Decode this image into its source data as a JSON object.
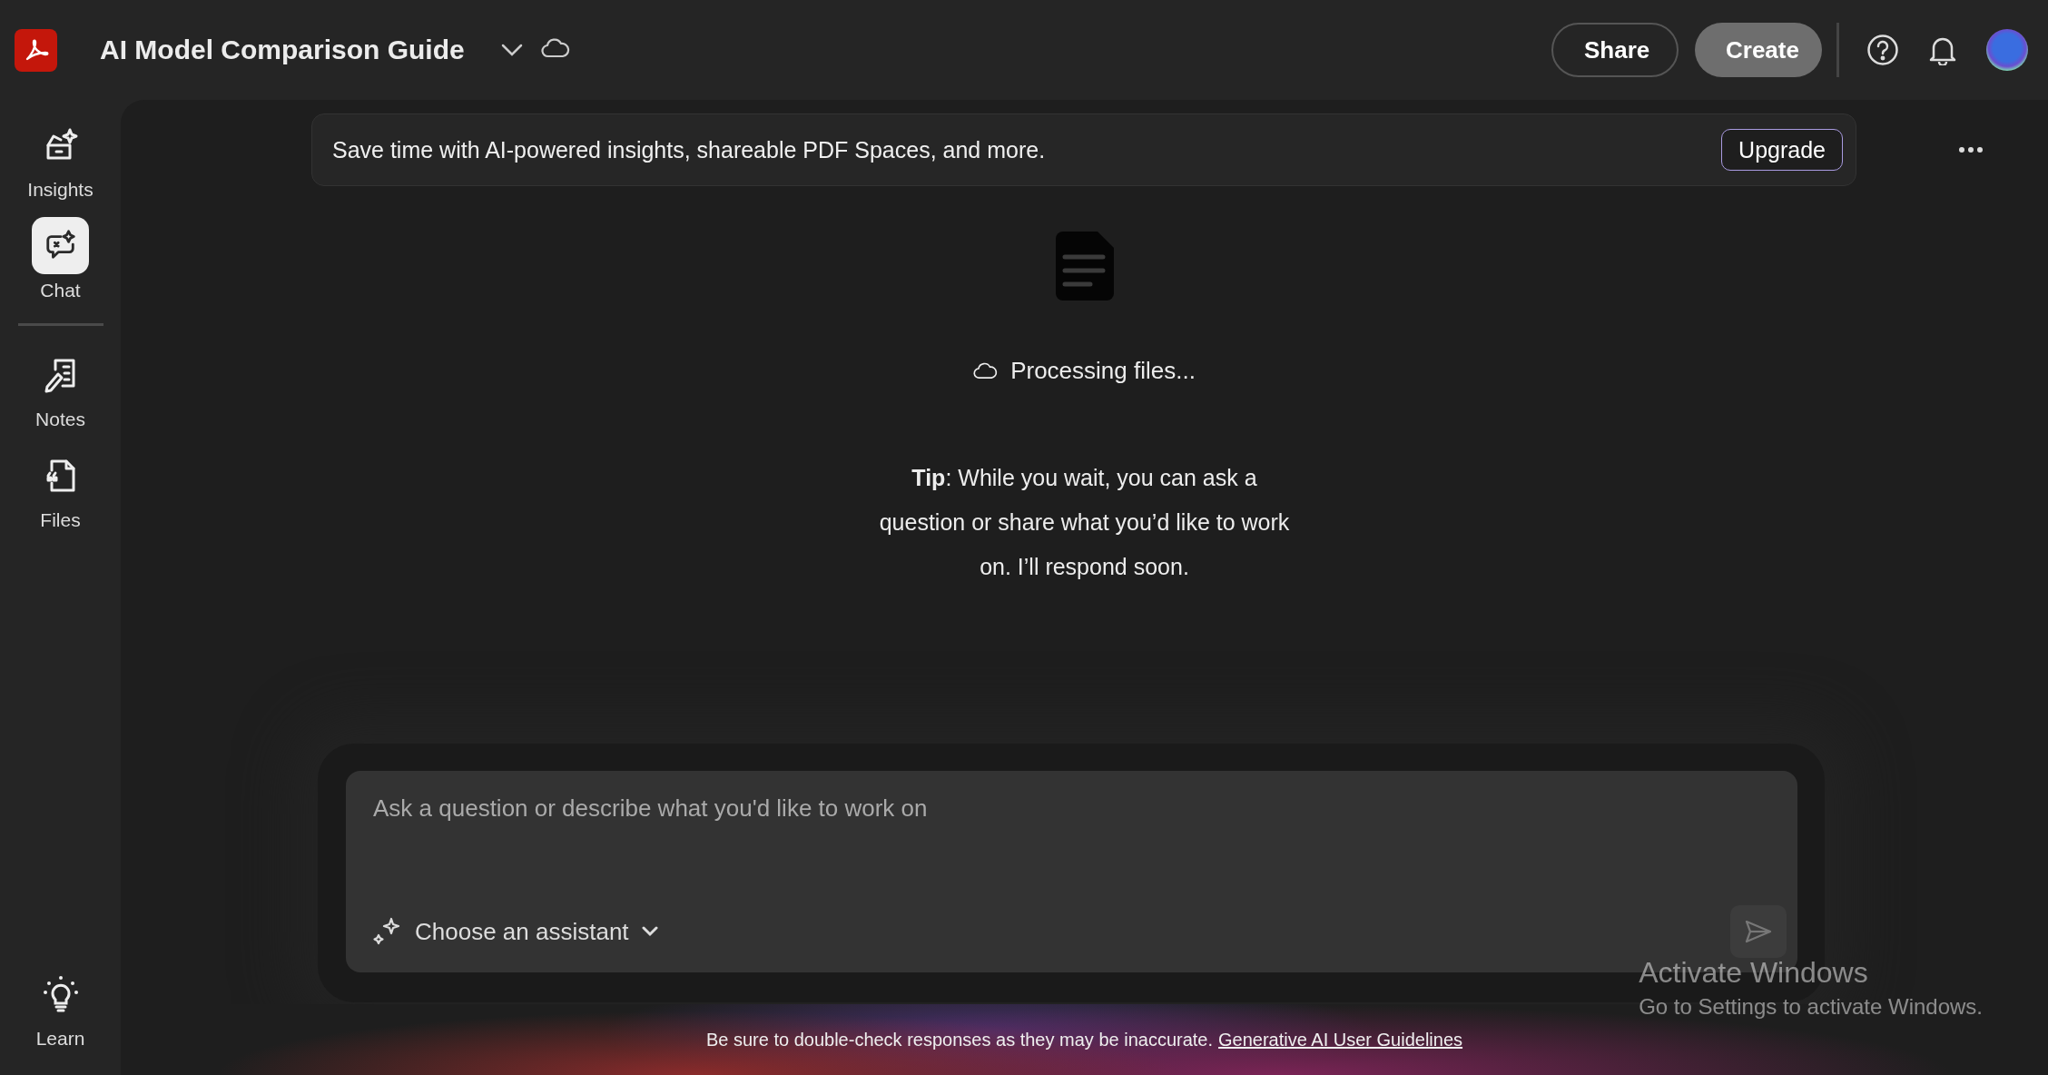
{
  "app": {
    "title": "AI Model Comparison Guide"
  },
  "header_actions": {
    "share": "Share",
    "create": "Create"
  },
  "sidebar": {
    "items": [
      {
        "label": "Insights",
        "kind": "insights",
        "selected": false
      },
      {
        "label": "Chat",
        "kind": "chat",
        "selected": true
      },
      {
        "label": "Notes",
        "kind": "notes",
        "selected": false
      },
      {
        "label": "Files",
        "kind": "files",
        "selected": false
      }
    ],
    "footer_item": {
      "label": "Learn",
      "kind": "learn"
    }
  },
  "banner": {
    "text": "Save time with AI-powered insights, shareable PDF Spaces, and more.",
    "button": "Upgrade"
  },
  "status": {
    "text": "Processing files..."
  },
  "tip": {
    "text": "**Tip**: While you wait, you can ask a question or share what you’d like to work on. I’ll respond soon."
  },
  "composer": {
    "placeholder": "Ask a question or describe what you'd like to work on",
    "assistant": "Choose an assistant"
  },
  "footer": {
    "text": "Be sure to double-check responses as they may be inaccurate.",
    "link": "Generative AI User Guidelines"
  },
  "os_overlay": {
    "title": "Activate Windows",
    "subtitle": "Go to Settings to activate Windows."
  }
}
